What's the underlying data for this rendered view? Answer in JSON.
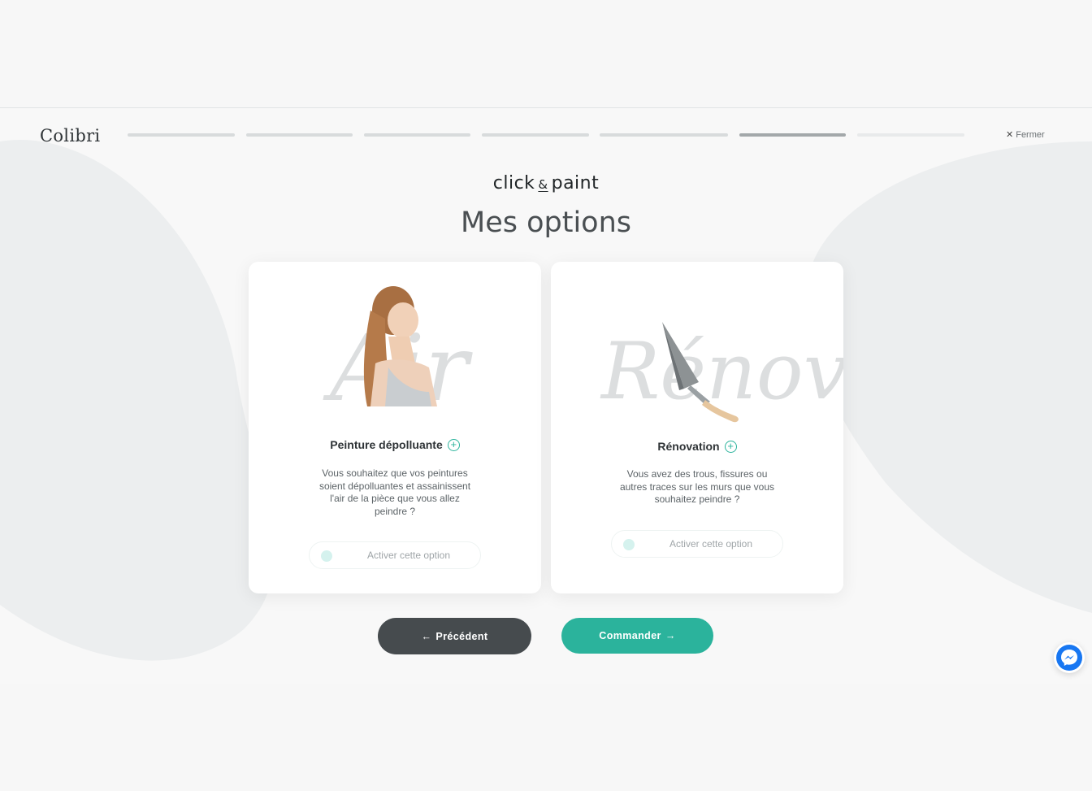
{
  "header": {
    "logo_text": "Colibri",
    "close_label": "Fermer",
    "progress_steps": [
      {
        "state": "done"
      },
      {
        "state": "done"
      },
      {
        "state": "done"
      },
      {
        "state": "done"
      },
      {
        "state": "done"
      },
      {
        "state": "active"
      },
      {
        "state": "upcoming"
      }
    ]
  },
  "brand": {
    "left": "click",
    "amp": "&",
    "right": "paint"
  },
  "page": {
    "title": "Mes options"
  },
  "options": [
    {
      "title": "Peinture dépolluante",
      "description": "Vous souhaitez que vos peintures soient dépolluantes et assainissent l'air de la pièce que vous allez peindre ?",
      "toggle_label": "Activer cette option",
      "script_word": "Air",
      "icon": "woman-breathing-image"
    },
    {
      "title": "Rénovation",
      "description": "Vous avez des trous, fissures ou autres traces sur les murs que vous souhaitez peindre ?",
      "toggle_label": "Activer cette option",
      "script_word": "Rénov",
      "icon": "trowel-image"
    }
  ],
  "actions": {
    "prev_label": "Précédent",
    "next_label": "Commander"
  },
  "colors": {
    "accent": "#2bb39c",
    "dark_button": "#464b4e",
    "messenger": "#1877f2"
  }
}
